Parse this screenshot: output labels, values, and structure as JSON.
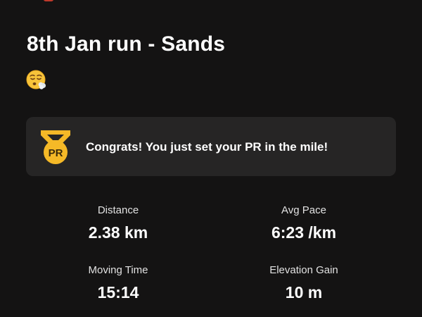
{
  "activity": {
    "title": "8th Jan run - Sands",
    "mood_icon": "exhausted-face-emoji"
  },
  "pr_banner": {
    "icon": "pr-medal-icon",
    "badge_text": "PR",
    "message": "Congrats! You just set your PR in the mile!"
  },
  "stats": {
    "distance": {
      "label": "Distance",
      "value": "2.38 km"
    },
    "avg_pace": {
      "label": "Avg Pace",
      "value": "6:23 /km"
    },
    "moving_time": {
      "label": "Moving Time",
      "value": "15:14"
    },
    "elevation_gain": {
      "label": "Elevation Gain",
      "value": "10 m"
    }
  },
  "colors": {
    "background": "#141313",
    "card": "#262525",
    "medal_gold": "#f5b927",
    "medal_dark": "#3a2a0a"
  }
}
